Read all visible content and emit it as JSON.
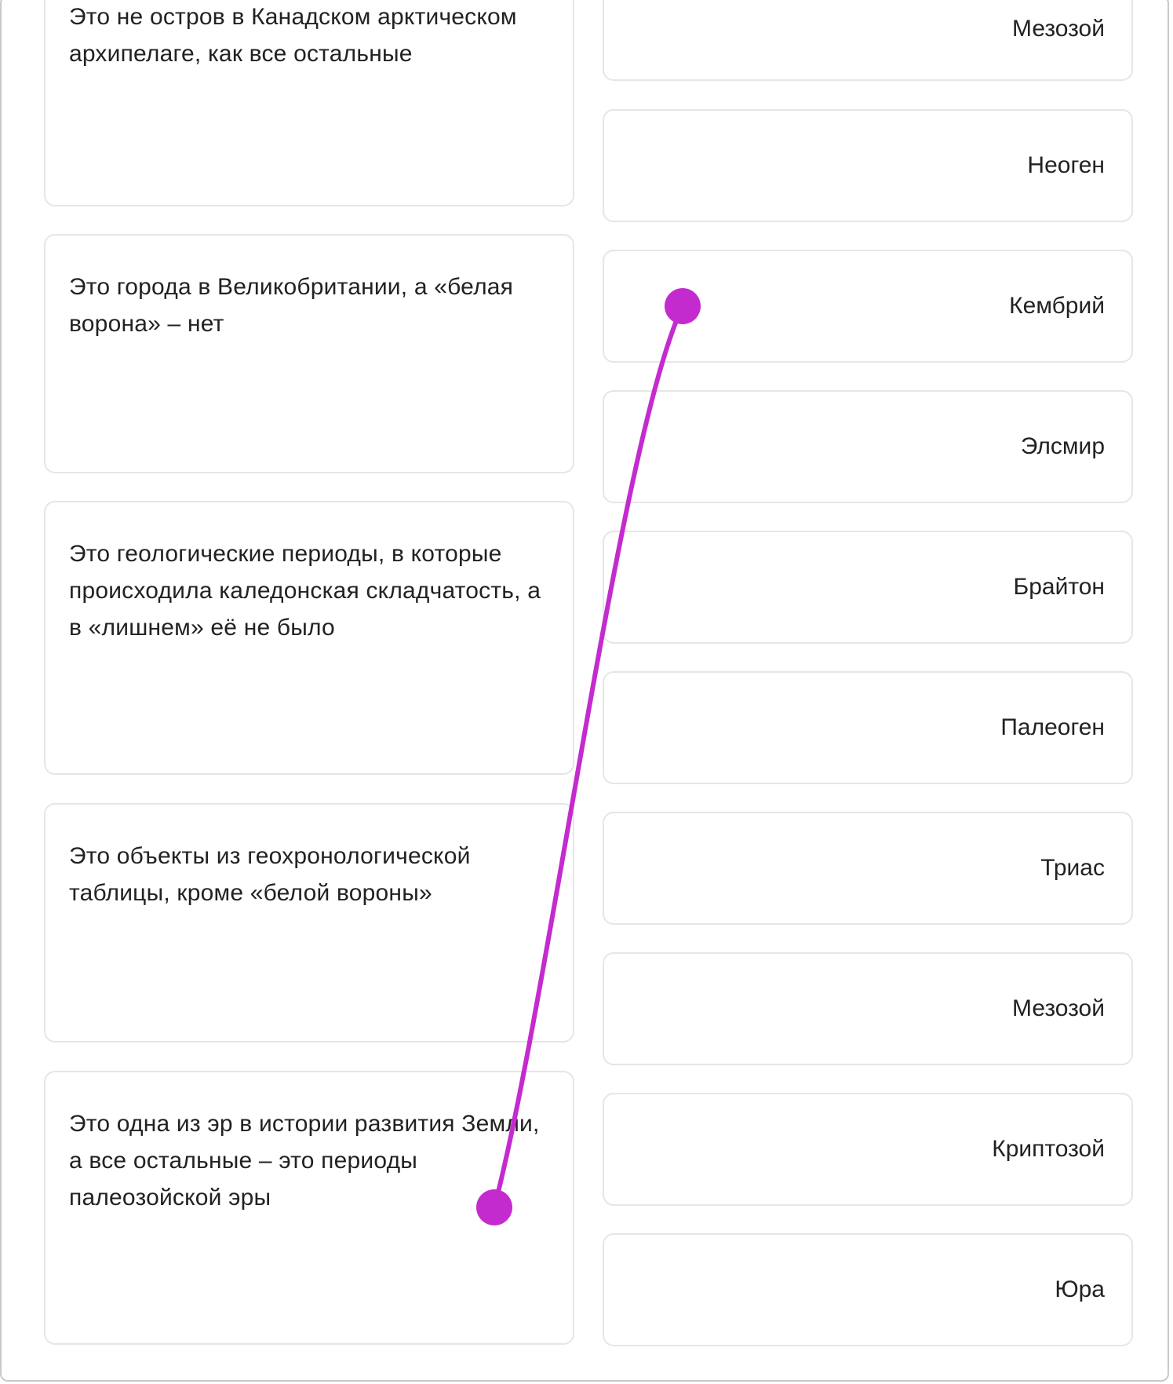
{
  "left_items": [
    {
      "text": "Это не остров в Канадском арктическом архипелаге, как все остальные"
    },
    {
      "text": "Это города в Великобритании, а «белая ворона» – нет"
    },
    {
      "text": "Это геологические периоды, в которые происходила каледонская складчатость, а в «лишнем» её не было"
    },
    {
      "text": "Это объекты из геохронологической таблицы, кроме «белой вороны»"
    },
    {
      "text": "Это одна из эр в истории развития Земли, а все остальные – это периоды палеозойской эры"
    }
  ],
  "right_items": [
    {
      "text": "Мезозой"
    },
    {
      "text": "Неоген"
    },
    {
      "text": "Кембрий"
    },
    {
      "text": "Элсмир"
    },
    {
      "text": "Брайтон"
    },
    {
      "text": "Палеоген"
    },
    {
      "text": "Триас"
    },
    {
      "text": "Мезозой"
    },
    {
      "text": "Криптозой"
    },
    {
      "text": "Юра"
    }
  ],
  "connection": {
    "from_left_index": 4,
    "to_right_index": 2,
    "color": "#c42bcf"
  }
}
